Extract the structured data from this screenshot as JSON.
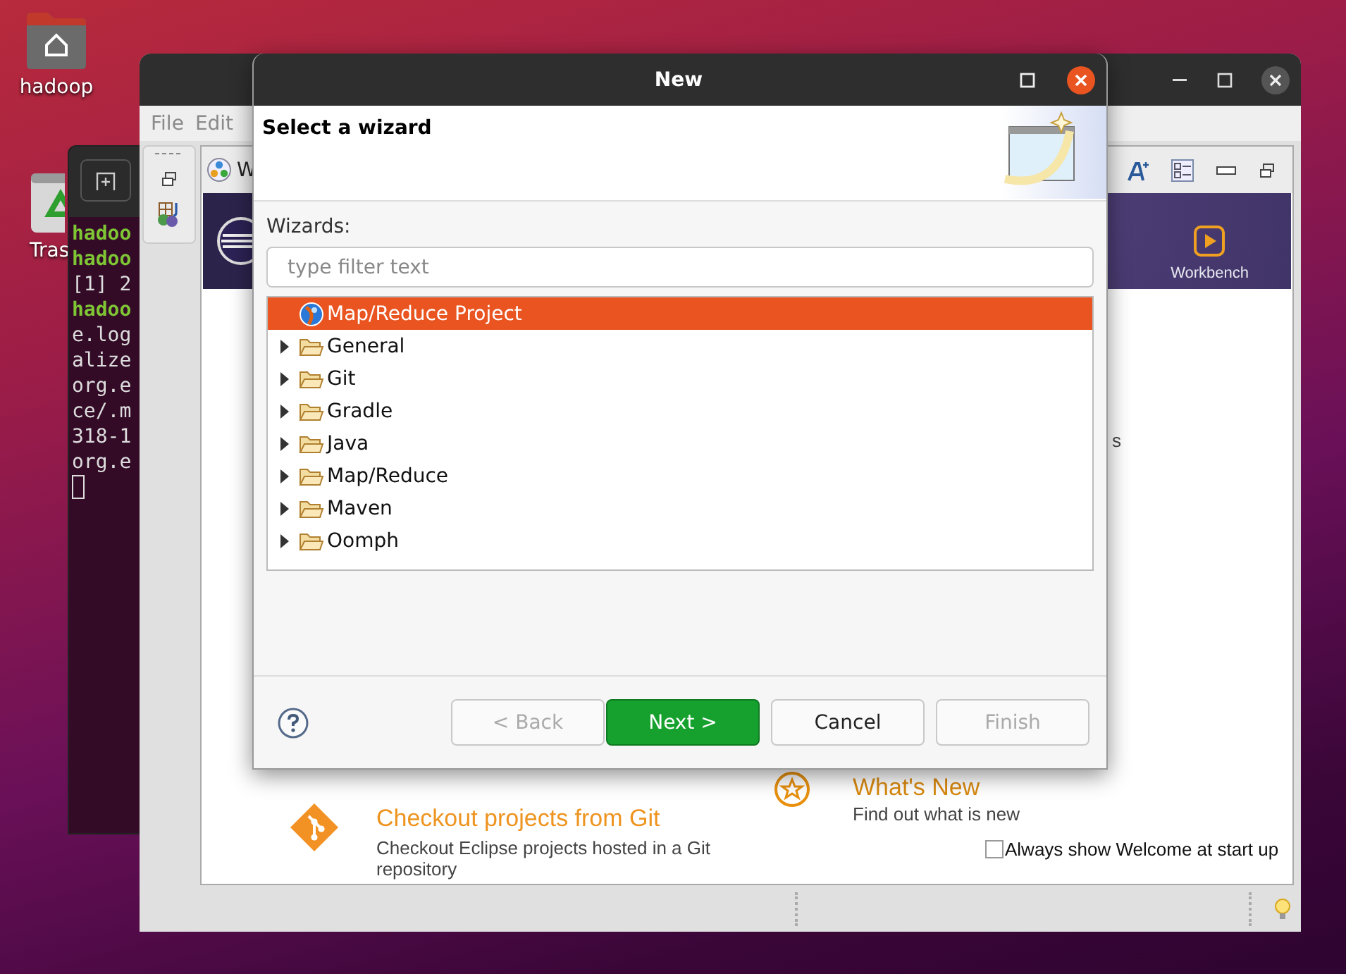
{
  "desktop": {
    "icons": [
      {
        "label": "hadoop",
        "kind": "home"
      },
      {
        "label": "Tras",
        "kind": "trash"
      }
    ]
  },
  "terminal": {
    "lines": [
      {
        "text": "hadoo",
        "kind": "prompt"
      },
      {
        "text": "hadoo",
        "kind": "prompt"
      },
      {
        "text": "[1] 2",
        "kind": "output"
      },
      {
        "text": "hadoo",
        "kind": "prompt"
      },
      {
        "text": "e.log",
        "kind": "output"
      },
      {
        "text": "alize",
        "kind": "output"
      },
      {
        "text": "org.e",
        "kind": "output"
      },
      {
        "text": "ce/.m",
        "kind": "output"
      },
      {
        "text": "318-1",
        "kind": "output"
      },
      {
        "text": "org.e",
        "kind": "output"
      }
    ]
  },
  "eclipse": {
    "menu": [
      "File",
      "Edit"
    ],
    "welcome": {
      "tab_label": "W",
      "banner_action": "Workbench",
      "fragment": "s",
      "items": [
        {
          "kind": "star",
          "title": "What's New",
          "description": "Find out what is new"
        },
        {
          "kind": "git",
          "title": "Checkout projects from Git",
          "description": "Checkout Eclipse projects hosted in a Git repository"
        }
      ],
      "always_show": {
        "label": "Always show Welcome at start up",
        "checked": false
      }
    }
  },
  "dialog": {
    "title": "New",
    "heading": "Select a wizard",
    "wizards_label": "Wizards:",
    "filter": {
      "placeholder": "type filter text"
    },
    "tree": [
      {
        "label": "Map/Reduce Project",
        "kind": "project",
        "selected": true
      },
      {
        "label": "General",
        "kind": "folder",
        "selected": false,
        "expanded": false
      },
      {
        "label": "Git",
        "kind": "folder",
        "selected": false,
        "expanded": false
      },
      {
        "label": "Gradle",
        "kind": "folder",
        "selected": false,
        "expanded": false
      },
      {
        "label": "Java",
        "kind": "folder",
        "selected": false,
        "expanded": false
      },
      {
        "label": "Map/Reduce",
        "kind": "folder",
        "selected": false,
        "expanded": false
      },
      {
        "label": "Maven",
        "kind": "folder",
        "selected": false,
        "expanded": false
      },
      {
        "label": "Oomph",
        "kind": "folder",
        "selected": false,
        "expanded": false
      }
    ],
    "buttons": [
      {
        "label": "< Back",
        "disabled": true,
        "default": false
      },
      {
        "label": "Next >",
        "disabled": false,
        "default": true
      },
      {
        "label": "Cancel",
        "disabled": false,
        "default": false
      },
      {
        "label": "Finish",
        "disabled": true,
        "default": false
      }
    ]
  }
}
